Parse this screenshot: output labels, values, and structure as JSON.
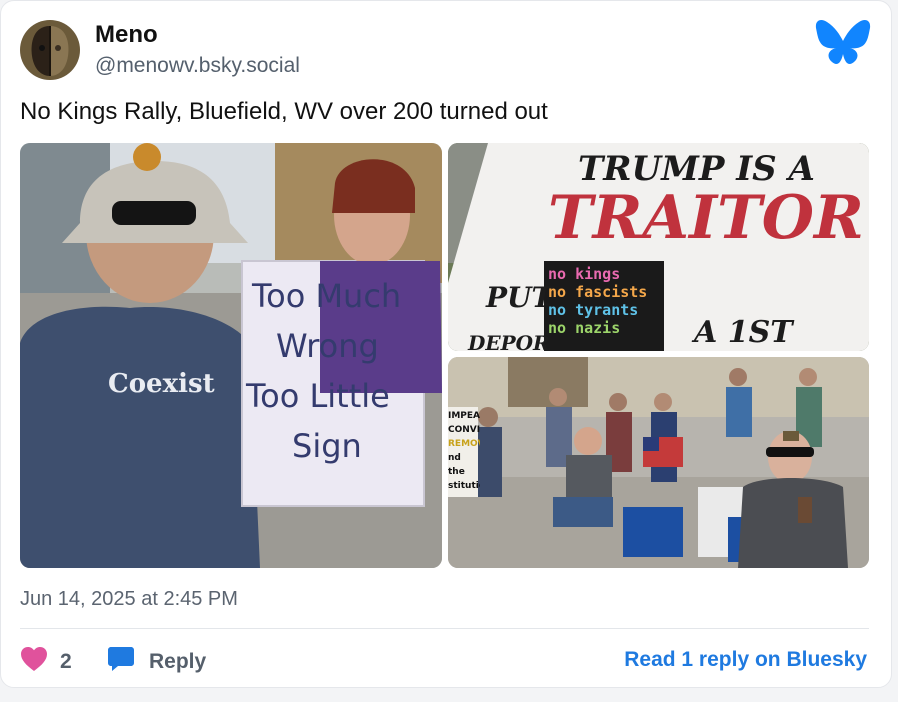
{
  "post": {
    "author_name": "Meno",
    "author_handle": "@menowv.bsky.social",
    "text": "No Kings Rally, Bluefield, WV over 200 turned out",
    "timestamp": "Jun 14, 2025 at 2:45 PM"
  },
  "images": {
    "left_sign": [
      "Too Much",
      "Wrong",
      "Too Little",
      "Sign"
    ],
    "shirt_text": "Coexist",
    "top_right_sign": [
      "TRUMP IS A",
      "TRAITOR",
      "PUT",
      "A 1ST",
      "DEPOR"
    ],
    "small_sign": [
      "no kings",
      "no fascists",
      "no tyrants",
      "no nazis"
    ],
    "bottom_right_sign": [
      "IMPEACH",
      "CONVICT",
      "REMOVE",
      "nd the",
      "stitution"
    ]
  },
  "actions": {
    "like_count": "2",
    "reply_label": "Reply",
    "read_more_label": "Read 1 reply on Bluesky"
  },
  "colors": {
    "like": "#e0529c",
    "reply": "#1f7ae0",
    "brand": "#1185fe"
  },
  "icons": {
    "like": "heart-icon",
    "reply": "speech-bubble-icon",
    "brand": "bluesky-butterfly-icon"
  }
}
